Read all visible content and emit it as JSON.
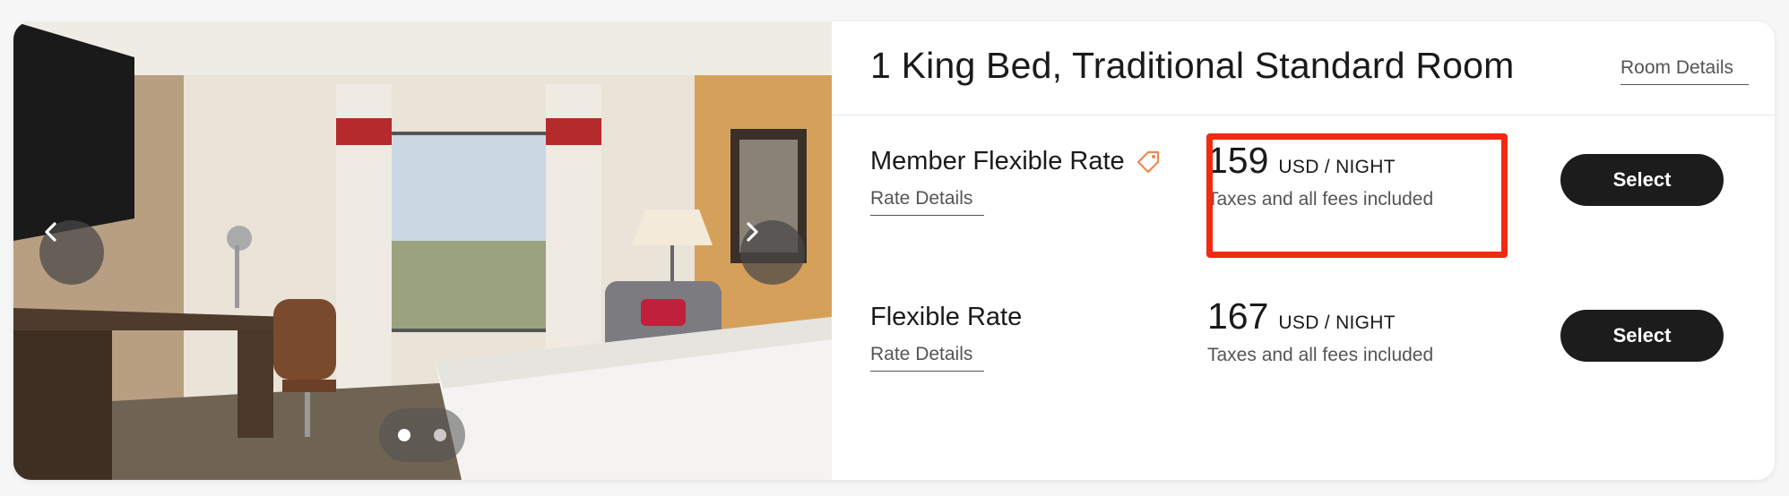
{
  "room": {
    "title": "1 King Bed, Traditional Standard Room",
    "details_link": "Room Details"
  },
  "gallery": {
    "prev_icon": "chevron-left-icon",
    "next_icon": "chevron-right-icon",
    "active_slide": 1,
    "slide_count": 2
  },
  "rates": [
    {
      "name": "Member Flexible Rate",
      "badge_icon": "tag-icon",
      "details_link": "Rate Details",
      "price": "159",
      "unit": "USD / NIGHT",
      "note": "Taxes and all fees included",
      "button": "Select",
      "highlighted": true
    },
    {
      "name": "Flexible Rate",
      "details_link": "Rate Details",
      "price": "167",
      "unit": "USD / NIGHT",
      "note": "Taxes and all fees included",
      "button": "Select",
      "highlighted": false
    }
  ],
  "colors": {
    "highlight": "#f22a12",
    "button_bg": "#1c1c1c",
    "tag_icon": "#f0874f"
  }
}
